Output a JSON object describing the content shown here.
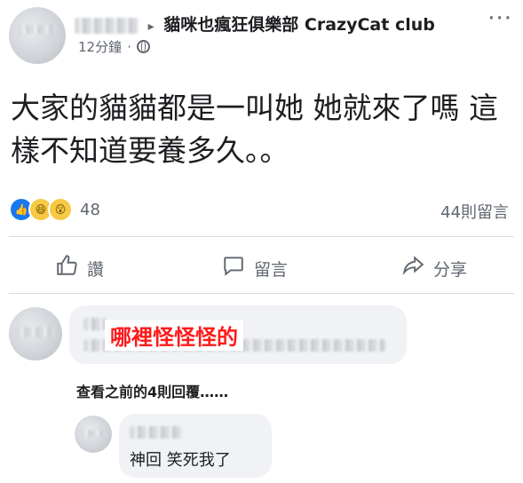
{
  "post": {
    "group_arrow": "▸",
    "group_name": "貓咪也瘋狂俱樂部 CrazyCat club",
    "time": "12分鐘",
    "dot": "·",
    "more": "···",
    "body": "大家的貓貓都是一叫她 她就來了嗎 這樣不知道要養多久。。"
  },
  "reactions": {
    "icons": [
      "like-icon",
      "haha-icon",
      "wow-icon"
    ],
    "count": "48",
    "comments": "44則留言"
  },
  "actions": {
    "like": "讚",
    "comment": "留言",
    "share": "分享"
  },
  "comment1": {
    "overlay": "哪裡怪怪怪的"
  },
  "replies": {
    "view_previous": "查看之前的4則回覆……"
  },
  "reply1": {
    "text": "神回 笑死我了"
  },
  "colors": {
    "accent": "#1877f2",
    "overlay_red": "#ff1a1a",
    "bubble": "#f0f2f5"
  }
}
